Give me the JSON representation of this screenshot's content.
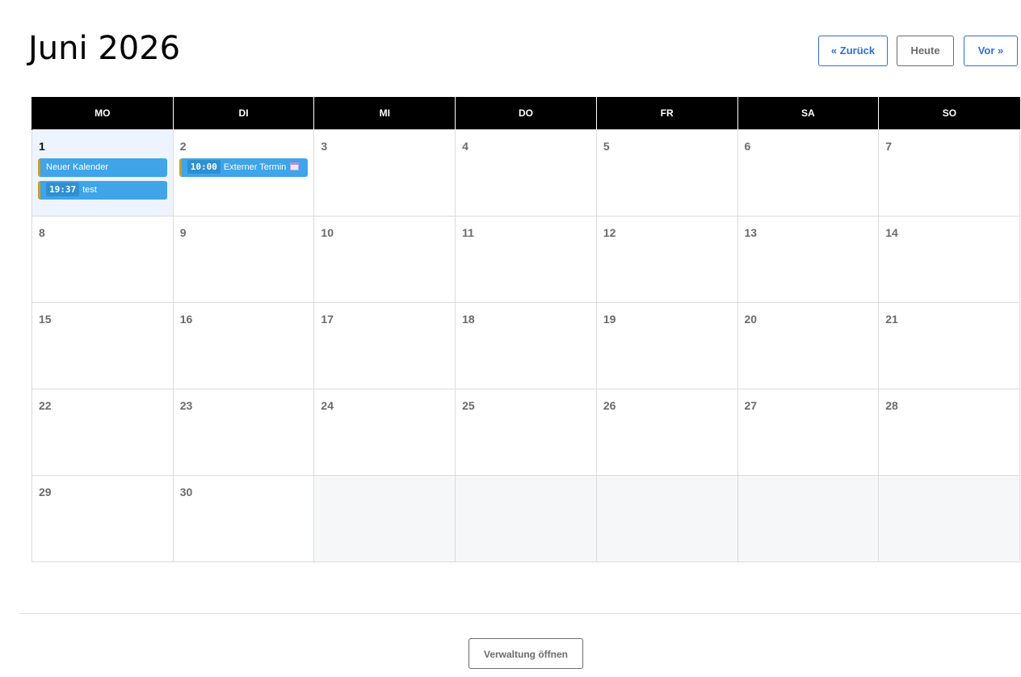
{
  "header": {
    "title": "Juni 2026",
    "prev_label": "« Zurück",
    "today_label": "Heute",
    "next_label": "Vor »"
  },
  "calendar": {
    "weekdays": [
      "MO",
      "DI",
      "MI",
      "DO",
      "FR",
      "SA",
      "SO"
    ],
    "today": 1,
    "weeks": [
      [
        {
          "day": "1",
          "events": [
            {
              "time": "",
              "title": "Neuer Kalender",
              "icon": ""
            },
            {
              "time": "19:37",
              "title": "test",
              "icon": ""
            }
          ]
        },
        {
          "day": "2",
          "events": [
            {
              "time": "10:00",
              "title": "Externer Termin",
              "icon": "calendar-icon"
            }
          ]
        },
        {
          "day": "3",
          "events": []
        },
        {
          "day": "4",
          "events": []
        },
        {
          "day": "5",
          "events": []
        },
        {
          "day": "6",
          "events": []
        },
        {
          "day": "7",
          "events": []
        }
      ],
      [
        {
          "day": "8",
          "events": []
        },
        {
          "day": "9",
          "events": []
        },
        {
          "day": "10",
          "events": []
        },
        {
          "day": "11",
          "events": []
        },
        {
          "day": "12",
          "events": []
        },
        {
          "day": "13",
          "events": []
        },
        {
          "day": "14",
          "events": []
        }
      ],
      [
        {
          "day": "15",
          "events": []
        },
        {
          "day": "16",
          "events": []
        },
        {
          "day": "17",
          "events": []
        },
        {
          "day": "18",
          "events": []
        },
        {
          "day": "19",
          "events": []
        },
        {
          "day": "20",
          "events": []
        },
        {
          "day": "21",
          "events": []
        }
      ],
      [
        {
          "day": "22",
          "events": []
        },
        {
          "day": "23",
          "events": []
        },
        {
          "day": "24",
          "events": []
        },
        {
          "day": "25",
          "events": []
        },
        {
          "day": "26",
          "events": []
        },
        {
          "day": "27",
          "events": []
        },
        {
          "day": "28",
          "events": []
        }
      ],
      [
        {
          "day": "29",
          "events": []
        },
        {
          "day": "30",
          "events": []
        },
        {
          "day": "",
          "events": []
        },
        {
          "day": "",
          "events": []
        },
        {
          "day": "",
          "events": []
        },
        {
          "day": "",
          "events": []
        },
        {
          "day": "",
          "events": []
        }
      ]
    ]
  },
  "footer": {
    "admin_label": "Verwaltung öffnen"
  },
  "colors": {
    "accent": "#2f6fd6",
    "event": "#3fa4e8",
    "event_border": "#c9a227",
    "today_bg": "#eef4ff",
    "header_bg": "#000000"
  }
}
